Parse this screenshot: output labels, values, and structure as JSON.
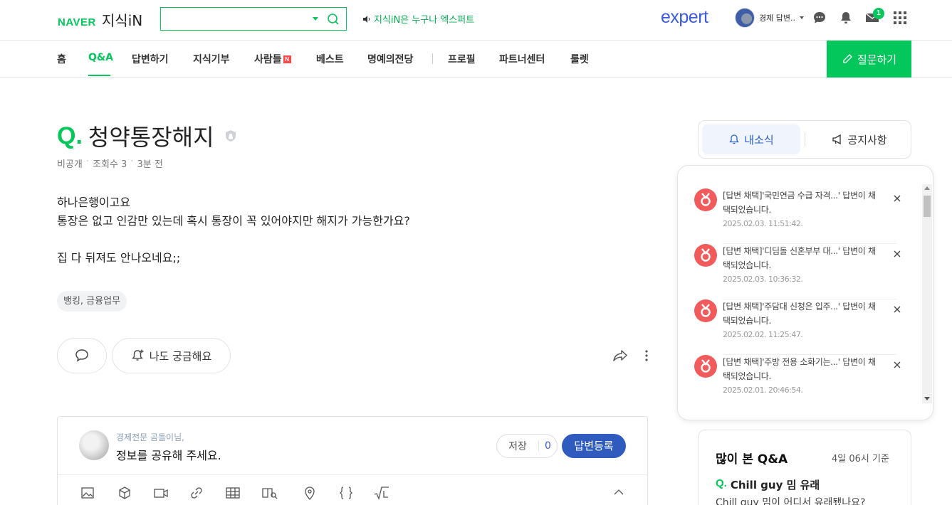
{
  "header": {
    "brand": "NAVER",
    "service": "지식iN",
    "search_placeholder": "",
    "promo": "지식iN은 누구나 엑스퍼트",
    "expert_logo": "expert",
    "user_name": "경제 답변..",
    "mail_count": "1"
  },
  "nav": {
    "items": [
      "홈",
      "Q&A",
      "답변하기",
      "지식기부",
      "사람들",
      "베스트",
      "명예의전당",
      "프로필",
      "파트너센터",
      "룰렛"
    ],
    "new_badge": "N",
    "ask_button": "질문하기"
  },
  "question": {
    "q_mark": "Q.",
    "title": "청약통장해지",
    "visibility": "비공개",
    "views": "조회수 3",
    "time": "3분 전",
    "body": [
      "하나은행이고요",
      "통장은 없고 인감만 있는데 혹시 통장이 꼭 있어야지만 해지가 가능한가요?",
      "",
      "집 다 뒤져도 안나오네요;;"
    ],
    "tag": "뱅킹, 금융업무",
    "curious_button": "나도 궁금해요"
  },
  "answer_box": {
    "rank": "경제전문 곰돌이님,",
    "prompt": "정보를 공유해 주세요.",
    "save_label": "저장",
    "save_count": "0",
    "submit_label": "답변등록"
  },
  "panel": {
    "tab_notice": "내소식",
    "tab_announce": "공지사항",
    "notifications": [
      {
        "message": "[답변 채택]'국민연금 수급 자격...' 답변이 채택되었습니다.",
        "date": "2025.02.03. 11:51:42."
      },
      {
        "message": "[답변 채택]'디딤돌 신혼부부 대...' 답변이 채택되었습니다.",
        "date": "2025.02.03. 10:36:32."
      },
      {
        "message": "[답변 채택]'주담대 신청은 입주...' 답변이 채택되었습니다.",
        "date": "2025.02.02. 11:25:47."
      },
      {
        "message": "[답변 채택]'주방 전용 소화기는...' 답변이 채택되었습니다.",
        "date": "2025.02.01. 20:46:54."
      }
    ]
  },
  "popular": {
    "title": "많이 본 Q&A",
    "date": "4일 06시 기준",
    "q_mark": "Q.",
    "question": "Chill guy 밈 유래",
    "sub": "Chill guy 밈이 어디서 유래됐나요?"
  },
  "colors": {
    "brand_green": "#03c75a",
    "submit_blue": "#2e5bbd",
    "expert_blue": "#3b5bdb",
    "notice_red": "#f15b5b"
  },
  "icons": [
    "search-icon",
    "speaker-icon",
    "chat-icon",
    "bell-icon",
    "mail-icon",
    "apps-grid-icon",
    "pencil-icon",
    "lock-icon",
    "comment-icon",
    "bell-plus-icon",
    "share-icon",
    "more-icon",
    "close-icon"
  ]
}
